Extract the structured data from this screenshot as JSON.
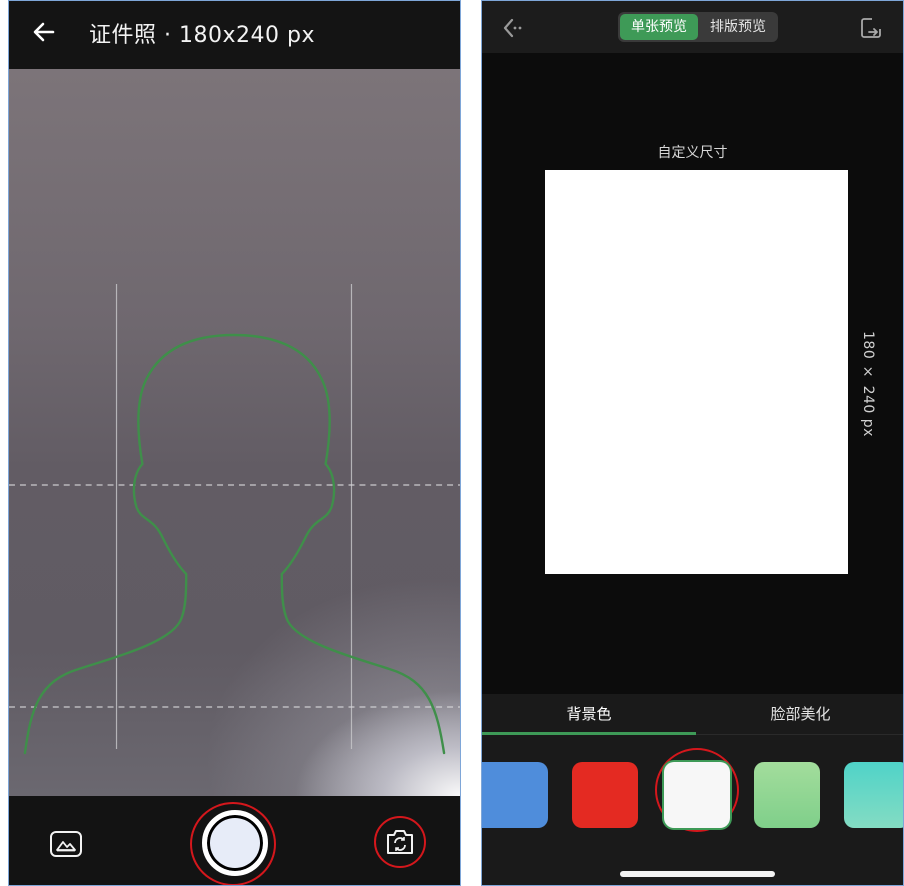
{
  "camera": {
    "title": "证件照 · 180x240 px",
    "back_icon": "arrow-left-icon",
    "gallery_icon": "gallery-icon",
    "shutter_icon": "shutter-button",
    "flip_icon": "camera-flip-icon",
    "guide_color": "#3f8f4a",
    "highlight_color": "#d4171c"
  },
  "preview": {
    "tabs_top": [
      "单张预览",
      "排版预览"
    ],
    "size_label": "自定义尺寸",
    "dimension_label": "180 × 240 px",
    "back_icon": "back-arrow-icon",
    "export_icon": "export-icon",
    "bottom_tabs": [
      "背景色",
      "脸部美化"
    ],
    "swatches": [
      {
        "name": "blue",
        "color": "#4f8ddb"
      },
      {
        "name": "red",
        "color": "#e42a22"
      },
      {
        "name": "white",
        "color": "#f7f7f7",
        "selected": true
      },
      {
        "name": "green-gradient",
        "color": "#8dd694"
      },
      {
        "name": "teal-gradient",
        "color": "#55d1c9"
      }
    ],
    "accent_color": "#3e9a57"
  }
}
